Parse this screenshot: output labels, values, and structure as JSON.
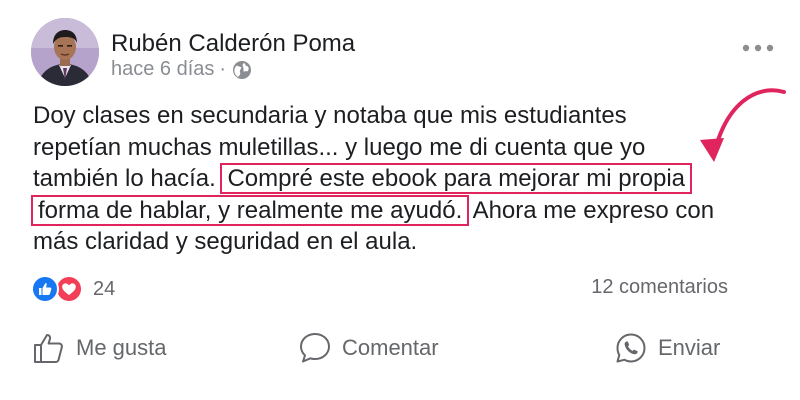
{
  "post": {
    "author": "Rubén Calderón Poma",
    "time": "hace 6 días",
    "separator": "·",
    "audience_icon": "globe-icon",
    "more_icon": "more-options-icon",
    "text_lines": [
      "Doy clases en secundaria y notaba que mis estudiantes",
      "repetían muchas muletillas... y luego me di cuenta que yo",
      "también lo hacía."
    ],
    "highlight_1": "Compré este ebook para mejorar mi propia",
    "highlight_2": "forma de hablar, y realmente me ayudó.",
    "after_highlight": "Ahora me expreso con",
    "last_line": "más claridad y seguridad en el aula.",
    "reactions_count": "24",
    "comments": "12 comentarios"
  },
  "actions": {
    "like": "Me gusta",
    "comment": "Comentar",
    "share": "Enviar"
  },
  "colors": {
    "highlight_border": "#e0245e",
    "arrow": "#e0245e",
    "like_blue": "#1877f2",
    "love_red": "#f33e58",
    "secondary_text": "#65676b"
  }
}
